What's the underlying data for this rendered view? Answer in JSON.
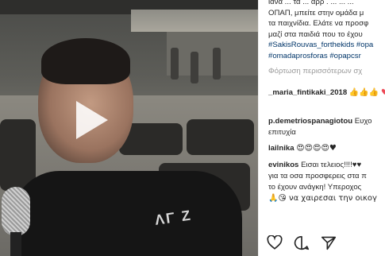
{
  "post": {
    "caption_lines": [
      "ΟΠΑΠ, μπείτε στην ομάδα μ",
      "τα παιχνίδια. Ελάτε να προσφ",
      "μαζί στα παιδιά που το έχου"
    ],
    "caption_top_fragment": "ιανα ... τα ... αρρ . ... ... ...",
    "hashtags_line1": "#SakisRouvas_forthekids #opa",
    "hashtags_line2": "#omadaprosforas #opapcsr",
    "load_more": "Φόρτωση περισσότερων σχ"
  },
  "comments": [
    {
      "user": "_maria_fintikaki_2018",
      "text": "👍👍👍",
      "text2": "♥♥♥"
    },
    {
      "user": "p.demetriospanagiotou",
      "text": "Ευχο",
      "text2": "επιτυχία"
    },
    {
      "user": "lailnika",
      "text": "😍😍😍😍♥"
    },
    {
      "user": "evinikos",
      "text": "Eισαι τελειος!!!!♥♥",
      "text2": "για τα οσα προσφερεις στα π",
      "text3": "το έχουν ανάγκη! Υπεροχος",
      "text4": "🙏😘 να χαιρεσαι την οικογ"
    }
  ],
  "video": {
    "shirt_print": "ΛΓ Ζ"
  },
  "icons": {
    "play": "play-icon",
    "like": "heart-outline-icon",
    "comment": "comment-bubble-icon",
    "share": "share-plane-icon",
    "save": "bookmark-icon"
  },
  "colors": {
    "hashtag": "#003569",
    "heart": "#ed4956",
    "muted": "#999999"
  }
}
